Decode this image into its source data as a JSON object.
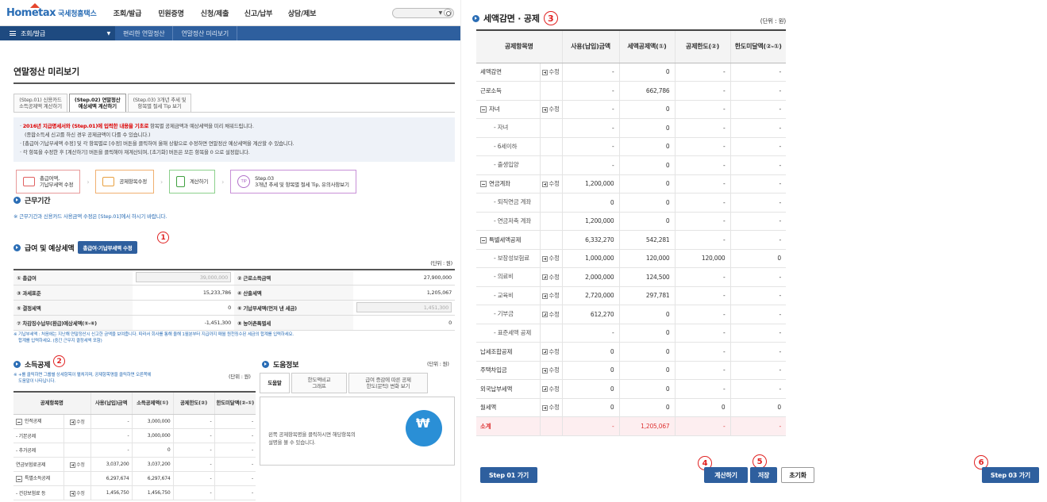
{
  "header": {
    "logo": "Hometax",
    "logo_sub": "국세청홈택스",
    "menu": [
      "조회/발급",
      "민원증명",
      "신청/제출",
      "신고/납부",
      "상담/제보"
    ]
  },
  "nav": {
    "home": "조회/발급",
    "crumbs": [
      "편리한 연말정산",
      "연말정산 미리보기"
    ]
  },
  "page_title": "연말정산 미리보기",
  "step_tabs": [
    {
      "line1": "(Step.01) 신용카드",
      "line2": "소득공제액 계산하기"
    },
    {
      "line1": "(Step.02) 연말정산",
      "line2": "예상세액 계산하기"
    },
    {
      "line1": "(Step.03) 3개년 추세 및",
      "line2": "항목별 절세 Tip 보기"
    }
  ],
  "notice": {
    "l1_red": "2016년 지급명세서와 (Step.01)에 입력한 내용을 기초로",
    "l1_rest": " 항목별 공제금액과 예상세액을 미리 채워드립니다.",
    "l2": "(종합소득세 신고를 하신 경우 공제금액이 다를 수 있습니다.)",
    "l3": "[총급여·기납부세액 수정] 및 각 항목별로 [수정] 버튼을 클릭하여 올해 상황으로 수정하면 연말정산 예상세액을 계산할 수 있습니다.",
    "l4": "각 항목을 수정한 후 [계산하기] 버튼을 클릭해야 재계산되며, [초기화] 버튼은 모든 항목을 0 으로 설정합니다."
  },
  "flow": [
    {
      "line1": "총급여액,",
      "line2": "기납부세액 수정"
    },
    {
      "line1": "공제항목수정",
      "line2": ""
    },
    {
      "line1": "계산하기",
      "line2": ""
    },
    {
      "line1": "Step.03",
      "line2": "3개년 추세 및 항목별 절세 Tip, 유의사항보기"
    }
  ],
  "work": {
    "title": "근무기간",
    "note": "※ 근무기간과 신용카드 사용금액 수정은 [Step.01]에서 하시기 바랍니다."
  },
  "pay": {
    "title": "급여 및 예상세액",
    "button": "총급여·기납부세액 수정",
    "unit": "(단위 : 원)",
    "rows": [
      {
        "l1": "① 총급여",
        "v1": "39,000,000",
        "l2": "② 근로소득금액",
        "v2": "27,900,000"
      },
      {
        "l1": "③ 과세표준",
        "v1": "15,233,786",
        "l2": "④ 산출세액",
        "v2": "1,205,067"
      },
      {
        "l1": "⑤ 결정세액",
        "v1": "0",
        "l2": "⑥ 기납부세액(먼저 낸 세금)",
        "v2": "1,451,300"
      },
      {
        "l1": "⑦ 차감징수납부(환급)예상세액(⑤-⑥)",
        "v1": "-1,451,300",
        "l2": "⑧ 농어촌특별세",
        "v2": "0"
      }
    ],
    "note1": "※ 기납부세액 : 처음에는 지난해 연말정산시 신고한 금액을 보여줍니다. 따라서 회사를 통해 올해 1월분부터 지급까지 매월 원천징수된 세금의 합계를 입력하세요.",
    "note2": "합계를 입력하세요. (중간 근무지 결정세액 포함)"
  },
  "income": {
    "title": "소득공제",
    "note1": "※ +를 클릭하면 그룹별 상세항목이 펼쳐지며, 공제항목명을 클릭하면 오른쪽에",
    "note2": "도움말이 나타납니다.",
    "unit": "(단위 : 원)",
    "headers": [
      "공제항목명",
      "사용(납입)금액",
      "소득공제액(①)",
      "공제한도(②)",
      "한도미달액(②-①)"
    ],
    "edit": "수정",
    "rows": [
      {
        "name": "인적공제",
        "edit": true,
        "pm": true,
        "sub": false,
        "c1": "-",
        "c2": "3,000,000",
        "c3": "-",
        "c4": "-"
      },
      {
        "name": "- 기본공제",
        "edit": false,
        "pm": false,
        "sub": true,
        "c1": "-",
        "c2": "3,000,000",
        "c3": "-",
        "c4": "-"
      },
      {
        "name": "- 추가공제",
        "edit": false,
        "pm": false,
        "sub": true,
        "c1": "-",
        "c2": "0",
        "c3": "-",
        "c4": "-"
      },
      {
        "name": "연금보험료공제",
        "edit": true,
        "pm": false,
        "sub": false,
        "c1": "3,037,200",
        "c2": "3,037,200",
        "c3": "-",
        "c4": "-"
      },
      {
        "name": "특별소득공제",
        "edit": false,
        "pm": true,
        "sub": false,
        "c1": "6,297,674",
        "c2": "6,297,674",
        "c3": "-",
        "c4": "-"
      },
      {
        "name": "- 건강보험료 등",
        "edit": true,
        "pm": false,
        "sub": true,
        "c1": "1,456,750",
        "c2": "1,456,750",
        "c3": "-",
        "c4": "-"
      }
    ]
  },
  "help": {
    "title": "도움정보",
    "unit": "(단위 : 원)",
    "tabs": [
      {
        "line1": "도움말",
        "line2": ""
      },
      {
        "line1": "한도액비교",
        "line2": "그래프"
      },
      {
        "line1": "급여 증감에 따른 공제",
        "line2": "한도(문턱) 변화 보기"
      }
    ],
    "body1": "왼쪽 공제항목명을 클릭하시면 해당항목의",
    "body2": "설명을 볼 수 있습니다."
  },
  "tax": {
    "title": "세액감면 · 공제",
    "unit": "(단위 : 원)",
    "headers": [
      "공제항목명",
      "사용(납입)금액",
      "세액공제액(①)",
      "공제한도(②)",
      "한도미달액(②-①)"
    ],
    "edit": "수정",
    "rows": [
      {
        "name": "세액감면",
        "edit": true,
        "pm": false,
        "sub": false,
        "c1": "-",
        "c2": "0",
        "c3": "-",
        "c4": "-"
      },
      {
        "name": "근로소득",
        "edit": false,
        "pm": false,
        "sub": false,
        "c1": "-",
        "c2": "662,786",
        "c3": "-",
        "c4": "-"
      },
      {
        "name": "자녀",
        "edit": true,
        "pm": true,
        "sub": false,
        "c1": "-",
        "c2": "0",
        "c3": "-",
        "c4": "-"
      },
      {
        "name": "- 자녀",
        "edit": false,
        "pm": false,
        "sub": true,
        "c1": "-",
        "c2": "0",
        "c3": "-",
        "c4": "-"
      },
      {
        "name": "- 6세이하",
        "edit": false,
        "pm": false,
        "sub": true,
        "c1": "-",
        "c2": "0",
        "c3": "-",
        "c4": "-"
      },
      {
        "name": "- 출생입양",
        "edit": false,
        "pm": false,
        "sub": true,
        "c1": "-",
        "c2": "0",
        "c3": "-",
        "c4": "-"
      },
      {
        "name": "연금계좌",
        "edit": true,
        "pm": true,
        "sub": false,
        "c1": "1,200,000",
        "c2": "0",
        "c3": "-",
        "c4": "-"
      },
      {
        "name": "- 퇴직연금 계좌",
        "edit": false,
        "pm": false,
        "sub": true,
        "c1": "0",
        "c2": "0",
        "c3": "-",
        "c4": "-"
      },
      {
        "name": "- 연금저축 계좌",
        "edit": false,
        "pm": false,
        "sub": true,
        "c1": "1,200,000",
        "c2": "0",
        "c3": "-",
        "c4": "-"
      },
      {
        "name": "특별세액공제",
        "edit": false,
        "pm": true,
        "sub": false,
        "c1": "6,332,270",
        "c2": "542,281",
        "c3": "-",
        "c4": "-"
      },
      {
        "name": "- 보장성보험료",
        "edit": true,
        "pm": false,
        "sub": true,
        "c1": "1,000,000",
        "c2": "120,000",
        "c3": "120,000",
        "c4": "0"
      },
      {
        "name": "- 의료비",
        "edit": true,
        "pm": false,
        "sub": true,
        "c1": "2,000,000",
        "c2": "124,500",
        "c3": "-",
        "c4": "-"
      },
      {
        "name": "- 교육비",
        "edit": true,
        "pm": false,
        "sub": true,
        "c1": "2,720,000",
        "c2": "297,781",
        "c3": "-",
        "c4": "-"
      },
      {
        "name": "- 기부금",
        "edit": true,
        "pm": false,
        "sub": true,
        "c1": "612,270",
        "c2": "0",
        "c3": "-",
        "c4": "-"
      },
      {
        "name": "- 표준세액 공제",
        "edit": false,
        "pm": false,
        "sub": true,
        "c1": "-",
        "c2": "0",
        "c3": "-",
        "c4": "-"
      },
      {
        "name": "납세조합공제",
        "edit": true,
        "pm": false,
        "sub": false,
        "c1": "0",
        "c2": "0",
        "c3": "-",
        "c4": "-"
      },
      {
        "name": "주택차입금",
        "edit": true,
        "pm": false,
        "sub": false,
        "c1": "0",
        "c2": "0",
        "c3": "-",
        "c4": "-"
      },
      {
        "name": "외국납부세액",
        "edit": true,
        "pm": false,
        "sub": false,
        "c1": "0",
        "c2": "0",
        "c3": "-",
        "c4": "-"
      },
      {
        "name": "월세액",
        "edit": true,
        "pm": false,
        "sub": false,
        "c1": "0",
        "c2": "0",
        "c3": "0",
        "c4": "0"
      }
    ],
    "total": {
      "name": "소계",
      "c1": "-",
      "c2": "1,205,067",
      "c3": "-",
      "c4": "-"
    }
  },
  "buttons": {
    "step01": "Step 01 가기",
    "calc": "계산하기",
    "save": "저장",
    "reset": "초기화",
    "step03": "Step 03 가기"
  },
  "markers": [
    "1",
    "2",
    "3",
    "4",
    "5",
    "6"
  ]
}
